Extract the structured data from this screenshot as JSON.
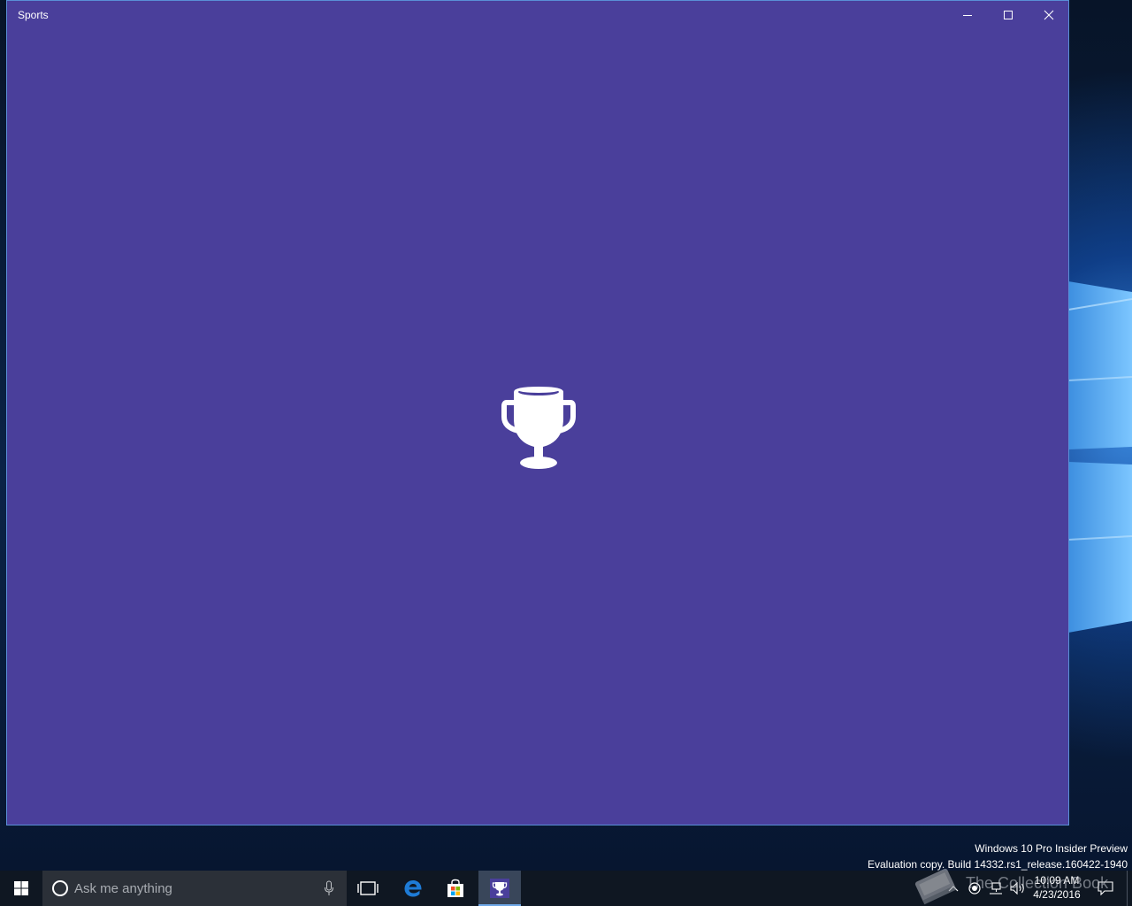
{
  "window": {
    "title": "Sports",
    "background": "#4a3f9b",
    "splash_icon": "trophy-icon",
    "controls": {
      "minimize_icon": "minimize-icon",
      "maximize_icon": "maximize-icon",
      "close_icon": "close-icon"
    }
  },
  "watermark": {
    "line1": "Windows 10 Pro Insider Preview",
    "line2": "Evaluation copy. Build 14332.rs1_release.160422-1940"
  },
  "taskbar": {
    "background": "#0f1722",
    "start_icon": "windows-logo-icon",
    "search": {
      "placeholder": "Ask me anything",
      "cortana_icon": "cortana-circle-icon",
      "mic_icon": "microphone-icon"
    },
    "items": [
      {
        "name": "Task View",
        "icon": "task-view-icon"
      },
      {
        "name": "Microsoft Edge",
        "icon": "edge-icon"
      },
      {
        "name": "Store",
        "icon": "store-icon"
      },
      {
        "name": "Sports",
        "icon": "trophy-icon",
        "active": true
      }
    ],
    "tray": {
      "time": "10:09 AM",
      "date": "4/23/2016",
      "icons": [
        "chevron-up-icon",
        "record-icon",
        "network-icon",
        "volume-icon",
        "notification-icon"
      ]
    },
    "overlay_logo_text": "The Collection Book"
  }
}
